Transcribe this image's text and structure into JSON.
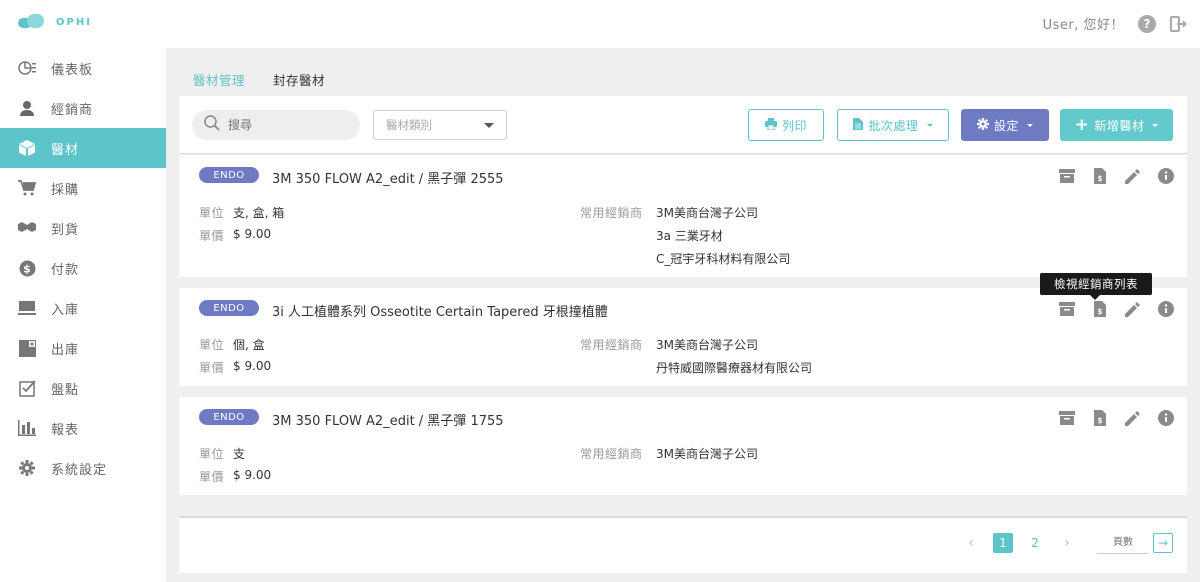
{
  "app": {
    "name": "OPHI"
  },
  "header": {
    "greeting": "User, 您好！"
  },
  "sidebar": {
    "items": [
      {
        "label": "儀表板",
        "icon": "dashboard-icon"
      },
      {
        "label": "經銷商",
        "icon": "user-icon"
      },
      {
        "label": "醫材",
        "icon": "box-icon",
        "active": true
      },
      {
        "label": "採購",
        "icon": "cart-icon"
      },
      {
        "label": "到貨",
        "icon": "handshake-icon"
      },
      {
        "label": "付款",
        "icon": "dollar-icon"
      },
      {
        "label": "入庫",
        "icon": "inbox-icon"
      },
      {
        "label": "出庫",
        "icon": "outbox-icon"
      },
      {
        "label": "盤點",
        "icon": "checkbox-icon"
      },
      {
        "label": "報表",
        "icon": "bar-chart-icon"
      },
      {
        "label": "系統設定",
        "icon": "gear-icon"
      }
    ]
  },
  "tabs": [
    {
      "label": "醫材管理",
      "active": true
    },
    {
      "label": "封存醫材"
    }
  ],
  "toolbar": {
    "search_placeholder": "搜尋",
    "category_placeholder": "醫材類別",
    "print_label": "列印",
    "batch_label": "批次處理",
    "settings_label": "設定",
    "add_label": "新增醫材"
  },
  "field_labels": {
    "unit": "單位",
    "price": "單價",
    "dealer": "常用經銷商"
  },
  "items": [
    {
      "category": "ENDO",
      "name": "3M 350 FLOW A2_edit / 黑子彈 2555",
      "unit": "支, 盒, 箱",
      "price": "$ 9.00",
      "dealers": [
        "3M美商台灣子公司",
        "3a 三業牙材",
        "C_冠宇牙科材料有限公司"
      ]
    },
    {
      "category": "ENDO",
      "name": "3i 人工植體系列 Osseotite Certain Tapered 牙根撞植體",
      "unit": "個, 盒",
      "price": "$ 9.00",
      "dealers": [
        "3M美商台灣子公司",
        "丹特威國際醫療器材有限公司"
      ]
    },
    {
      "category": "ENDO",
      "name": "3M 350 FLOW A2_edit / 黑子彈 1755",
      "unit": "支",
      "price": "$ 9.00",
      "dealers": [
        "3M美商台灣子公司"
      ]
    }
  ],
  "tooltip": "檢視經銷商列表",
  "pagination": {
    "pages": [
      "1",
      "2"
    ],
    "current": "1",
    "input_placeholder": "頁數"
  },
  "colors": {
    "accent": "#5ec4cc",
    "badge": "#6e7bc3"
  }
}
